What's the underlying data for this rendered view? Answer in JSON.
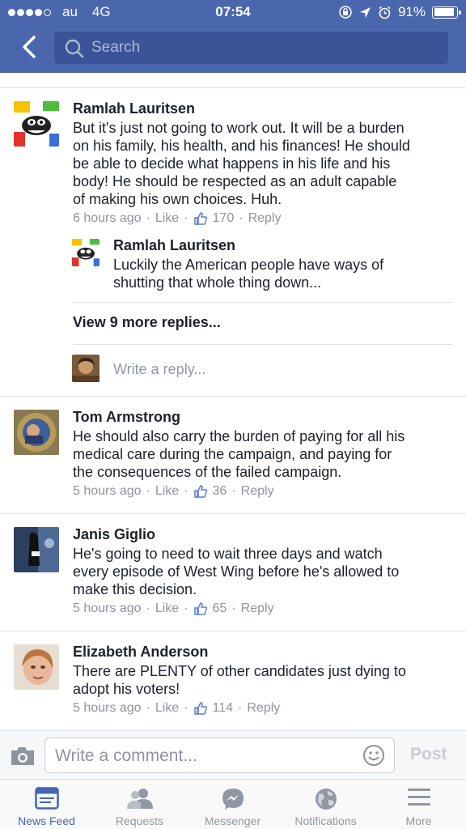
{
  "status_bar": {
    "carrier": "au",
    "network": "4G",
    "time": "07:54",
    "battery": "91%",
    "battery_level": 0.91
  },
  "header": {
    "back_icon": "chevron-left-icon",
    "search_placeholder": "Search"
  },
  "comments": [
    {
      "author": "Ramlah Lauritsen",
      "text": "But it's just not going to work out. It will be a burden\non his family, his health, and his finances! He should\nbe able to decide what happens in his life and his\nbody! He should be respected as an adult capable\nof making his own choices. Huh.",
      "time": "6 hours ago",
      "like_label": "Like",
      "likes": "170",
      "reply_label": "Reply",
      "replies": [
        {
          "author": "Ramlah Lauritsen",
          "text": "Luckily the American people have ways of\nshutting that whole thing down..."
        }
      ],
      "view_more_label": "View 9 more replies...",
      "reply_placeholder": "Write a reply..."
    },
    {
      "author": "Tom Armstrong",
      "text": "He should also carry the burden of paying for all his\nmedical care during the campaign, and paying for\nthe consequences of the failed campaign.",
      "time": "5 hours ago",
      "like_label": "Like",
      "likes": "36",
      "reply_label": "Reply"
    },
    {
      "author": "Janis Giglio",
      "text": "He's going to need to wait three days and watch\nevery episode of West Wing before he's allowed to\nmake this decision.",
      "time": "5 hours ago",
      "like_label": "Like",
      "likes": "65",
      "reply_label": "Reply"
    },
    {
      "author": "Elizabeth Anderson",
      "text": "There are PLENTY of other candidates just dying to\nadopt his voters!",
      "time": "5 hours ago",
      "like_label": "Like",
      "likes": "114",
      "reply_label": "Reply"
    }
  ],
  "composer": {
    "placeholder": "Write a comment...",
    "post_label": "Post"
  },
  "tabs": [
    {
      "label": "News Feed",
      "icon": "news-feed-icon",
      "active": true
    },
    {
      "label": "Requests",
      "icon": "friend-requests-icon",
      "active": false
    },
    {
      "label": "Messenger",
      "icon": "messenger-icon",
      "active": false
    },
    {
      "label": "Notifications",
      "icon": "globe-icon",
      "active": false
    },
    {
      "label": "More",
      "icon": "hamburger-menu-icon",
      "active": false
    }
  ],
  "colors": {
    "header_bg": "#4a67ad",
    "search_bg": "#3b5497",
    "text": "#1d2129",
    "meta": "#90949c",
    "active_tab": "#4267b2",
    "like_icon": "#5b7bd5"
  }
}
